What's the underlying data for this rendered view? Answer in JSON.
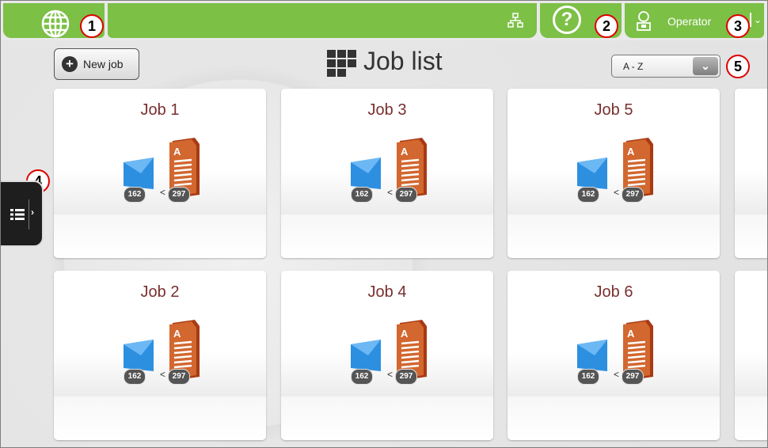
{
  "topbar": {
    "user_label": "Operator",
    "help_symbol": "?",
    "caret": "⌄",
    "accent_color": "#7cc046",
    "icons": [
      "globe-icon",
      "network-icon",
      "help-icon",
      "user-icon"
    ]
  },
  "callouts": [
    "1",
    "2",
    "3",
    "4",
    "5"
  ],
  "toolbar": {
    "new_job_label": "New job",
    "new_job_plus": "+",
    "page_title": "Job list",
    "sort_value": "A - Z",
    "sort_caret": "⌄"
  },
  "side_tab": {
    "chevron": "›"
  },
  "jobs": [
    {
      "name": "Job 1",
      "envelopes": "162",
      "documents": "297",
      "relation": "<"
    },
    {
      "name": "Job 3",
      "envelopes": "162",
      "documents": "297",
      "relation": "<"
    },
    {
      "name": "Job 5",
      "envelopes": "162",
      "documents": "297",
      "relation": "<"
    },
    {
      "name": "Job 2",
      "envelopes": "162",
      "documents": "297",
      "relation": "<"
    },
    {
      "name": "Job 4",
      "envelopes": "162",
      "documents": "297",
      "relation": "<"
    },
    {
      "name": "Job 6",
      "envelopes": "162",
      "documents": "297",
      "relation": "<"
    }
  ],
  "colors": {
    "job_title": "#7a2f2f",
    "envelope": "#2d8fe0",
    "document": "#cf5d2e",
    "callout_border": "#dd0000"
  }
}
